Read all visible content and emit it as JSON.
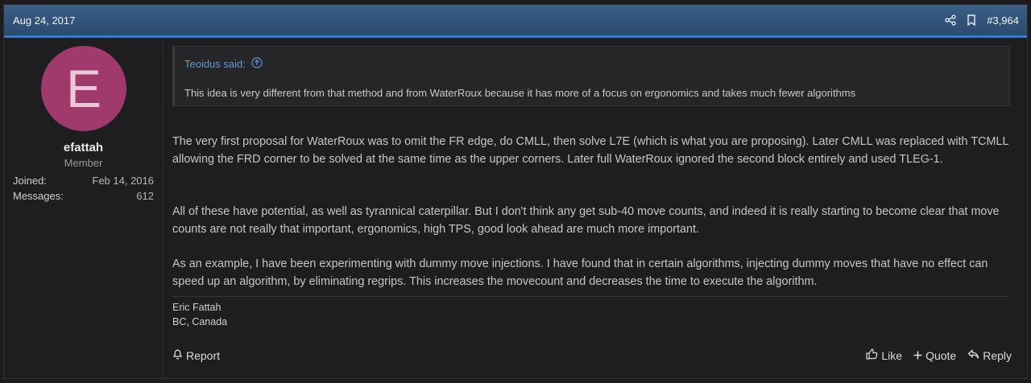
{
  "header": {
    "date": "Aug 24, 2017",
    "post_number": "#3,964",
    "share_icon": "share-icon",
    "bookmark_icon": "bookmark-icon"
  },
  "user": {
    "avatar_letter": "E",
    "avatar_color": "#a03a6c",
    "name": "efattah",
    "title": "Member",
    "joined_label": "Joined:",
    "joined_value": "Feb 14, 2016",
    "messages_label": "Messages:",
    "messages_value": "612"
  },
  "quote": {
    "author": "Teoidus said:",
    "text": "This idea is very different from that method and from WaterRoux because it has more of a focus on ergonomics and takes much fewer algorithms"
  },
  "body": {
    "p1": "The very first proposal for WaterRoux was to omit the FR edge, do CMLL, then solve L7E (which is what you are proposing). Later CMLL was replaced with TCMLL allowing the FRD corner to be solved at the same time as the upper corners. Later full WaterRoux ignored the second block entirely and used TLEG-1.",
    "p2": "All of these have potential, as well as tyrannical caterpillar. But I don't think any get sub-40 move counts, and indeed it is really starting to become clear that move counts are not really that important, ergonomics, high TPS, good look ahead are much more important.",
    "p3": "As an example, I have been experimenting with dummy move injections. I have found that in certain algorithms, injecting dummy moves that have no effect can speed up an algorithm, by eliminating regrips. This increases the movecount and decreases the time to execute the algorithm."
  },
  "signature": {
    "line1": "Eric Fattah",
    "line2": "BC, Canada"
  },
  "footer": {
    "report": "Report",
    "like": "Like",
    "quote": "Quote",
    "reply": "Reply"
  },
  "colors": {
    "header": "#2f5379",
    "accent": "#3a78c2",
    "link": "#5f98d4"
  }
}
